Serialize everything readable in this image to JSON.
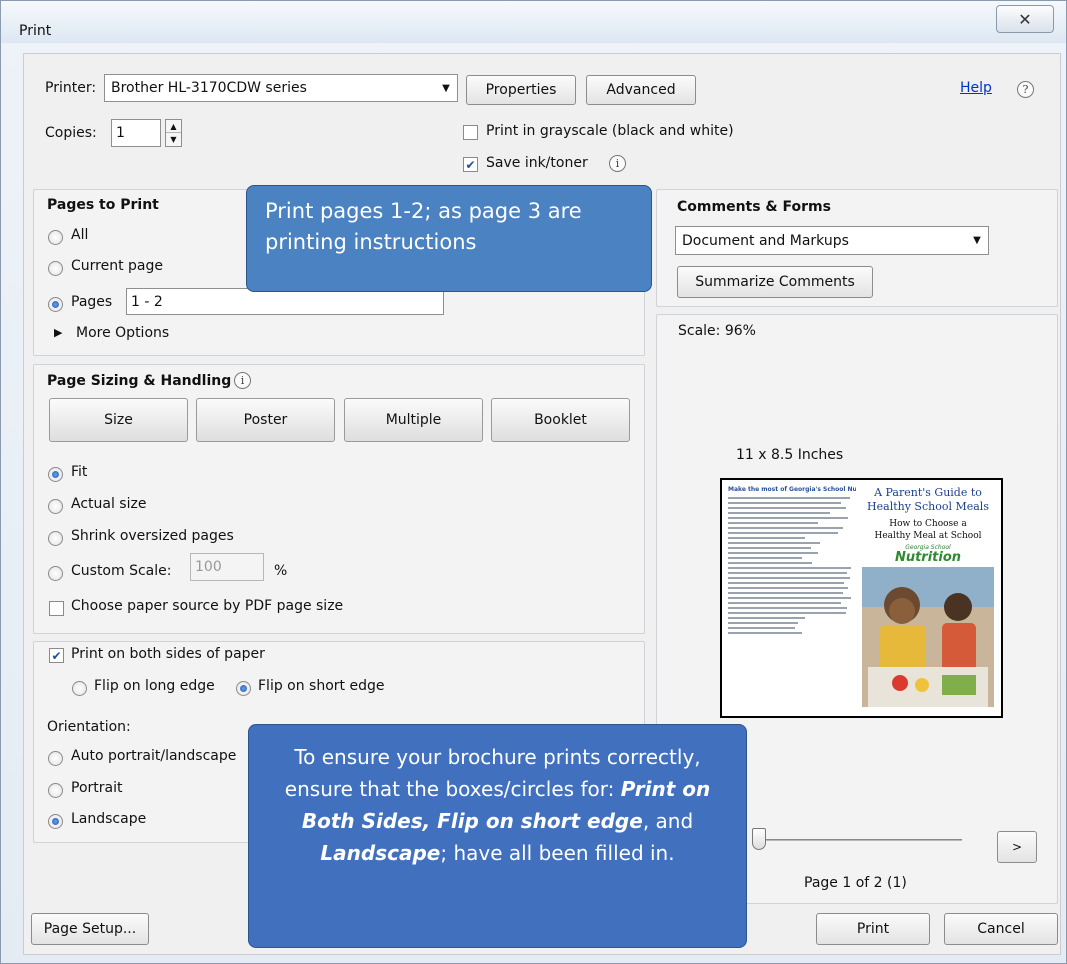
{
  "window": {
    "title": "Print",
    "close_glyph": "✕"
  },
  "printer": {
    "label": "Printer:",
    "selected": "Brother HL-3170CDW series",
    "properties_label": "Properties",
    "advanced_label": "Advanced",
    "help_label": "Help",
    "copies_label": "Copies:",
    "copies_value": "1",
    "grayscale_label": "Print in grayscale (black and white)",
    "grayscale_checked": false,
    "save_ink_label": "Save ink/toner",
    "save_ink_checked": true
  },
  "pages_to_print": {
    "heading": "Pages to Print",
    "all_label": "All",
    "current_label": "Current page",
    "pages_label": "Pages",
    "pages_value": "1 - 2",
    "selected": "pages",
    "more_options_label": "More Options"
  },
  "sizing": {
    "heading": "Page Sizing & Handling",
    "buttons": [
      "Size",
      "Poster",
      "Multiple",
      "Booklet"
    ],
    "fit_label": "Fit",
    "actual_label": "Actual size",
    "shrink_label": "Shrink oversized pages",
    "custom_label": "Custom Scale:",
    "custom_value": "100",
    "percent_label": "%",
    "selected": "fit",
    "paper_source_label": "Choose paper source by PDF page size",
    "paper_source_checked": false
  },
  "duplex": {
    "both_sides_label": "Print on both sides of paper",
    "both_sides_checked": true,
    "long_edge_label": "Flip on long edge",
    "short_edge_label": "Flip on short edge",
    "selected": "short"
  },
  "orientation": {
    "heading": "Orientation:",
    "auto_label": "Auto portrait/landscape",
    "portrait_label": "Portrait",
    "landscape_label": "Landscape",
    "selected": "landscape"
  },
  "comments": {
    "heading": "Comments & Forms",
    "selected": "Document and Markups",
    "summarize_label": "Summarize Comments"
  },
  "preview": {
    "scale_label": "Scale:  96%",
    "size_label": "11 x 8.5 Inches",
    "doc_heading": "Make the most of Georgia's School Nutrition Program",
    "doc_title_1": "A Parent's Guide to",
    "doc_title_2": "Healthy School Meals",
    "doc_sub_1": "How to Choose a",
    "doc_sub_2": "Healthy Meal at School",
    "doc_brand_small": "Georgia School",
    "doc_brand": "Nutrition",
    "next_label": ">",
    "page_indicator": "Page 1 of 2 (1)"
  },
  "footer": {
    "page_setup_label": "Page Setup...",
    "print_label": "Print",
    "cancel_label": "Cancel"
  },
  "callouts": {
    "top_text": "Print pages 1-2; as page 3 are printing instructions",
    "bottom_intro": "To ensure your brochure prints correctly, ensure that the boxes/circles for: ",
    "bottom_b1": "Print on Both Sides, Flip on short edge",
    "bottom_mid": ", and ",
    "bottom_b2": "Landscape",
    "bottom_end": "; have all been filled in."
  },
  "colors": {
    "callout_top": "#4a82c2",
    "callout_bottom": "#4170bf",
    "link": "#0033cc"
  }
}
